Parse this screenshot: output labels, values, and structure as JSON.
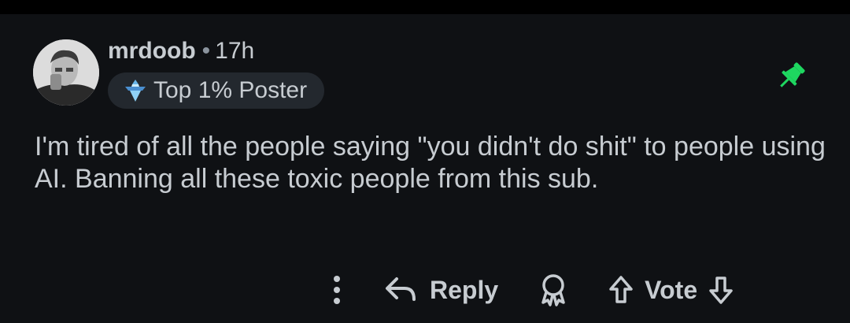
{
  "comment": {
    "author": "mrdoob",
    "separator": "•",
    "age": "17h",
    "flair": "Top 1% Poster",
    "body": "I'm tired of all the people saying \"you didn't do shit\" to people using AI. Banning all these toxic people from this sub.",
    "pinned": true
  },
  "actions": {
    "more_icon": "more-vertical-icon",
    "reply_label": "Reply",
    "award_icon": "award-icon",
    "vote_label": "Vote"
  },
  "colors": {
    "background": "#0f1114",
    "text": "#c7ccd1",
    "badge_bg": "#23282e",
    "pin": "#1ed760",
    "badge_accent": "#6ab7e9"
  }
}
